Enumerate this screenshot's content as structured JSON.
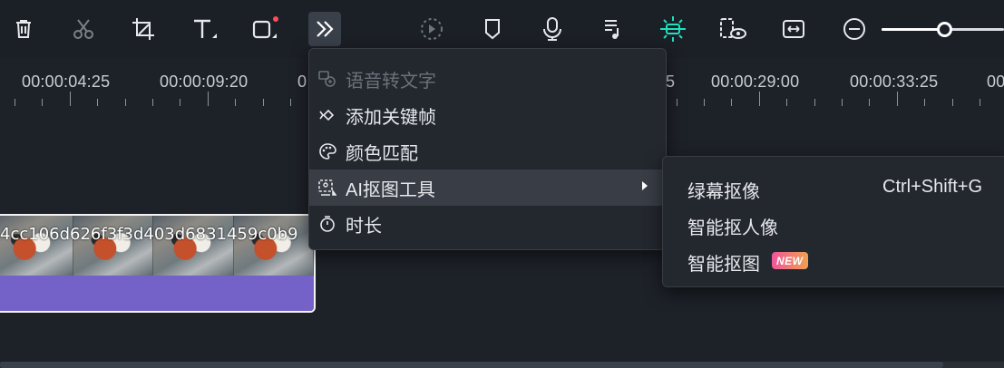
{
  "toolbar": {
    "buttons": [
      {
        "icon": "trash-icon",
        "name": "delete-button"
      },
      {
        "icon": "scissors-icon",
        "name": "split-button"
      },
      {
        "icon": "crop-icon",
        "name": "crop-button"
      },
      {
        "icon": "text-icon",
        "name": "text-button"
      },
      {
        "icon": "shape-icon",
        "name": "shape-button"
      },
      {
        "icon": "more-chevrons-icon",
        "name": "more-tools-button"
      },
      {
        "icon": "speed-icon",
        "name": "speed-button"
      },
      {
        "icon": "marker-icon",
        "name": "marker-button"
      },
      {
        "icon": "microphone-icon",
        "name": "record-voice-button"
      },
      {
        "icon": "music-list-icon",
        "name": "audio-button"
      },
      {
        "icon": "ai-track-icon",
        "name": "ai-button"
      },
      {
        "icon": "preview-render-icon",
        "name": "preview-button"
      },
      {
        "icon": "fit-width-icon",
        "name": "fit-button"
      },
      {
        "icon": "zoom-out-icon",
        "name": "zoom-out-button"
      }
    ],
    "zoom_level": 0.52,
    "accent_color": "#1fe0c0",
    "notification_dot_color": "#ff4d5a"
  },
  "ruler": {
    "timecodes": [
      "00:00:04:25",
      "00:00:09:20",
      "0",
      "5",
      "00:00:29:00",
      "00:00:33:25",
      "00"
    ]
  },
  "clip": {
    "name": "4cc106d626f3f3d403d6831459c0b9",
    "audio_color": "#7562c8"
  },
  "context_menu": {
    "items": [
      {
        "label": "语音转文字",
        "icon": "speech-to-text-icon",
        "disabled": true
      },
      {
        "label": "添加关键帧",
        "icon": "keyframe-icon",
        "disabled": false
      },
      {
        "label": "颜色匹配",
        "icon": "palette-icon",
        "disabled": false
      },
      {
        "label": "AI抠图工具",
        "icon": "ai-cutout-icon",
        "disabled": false,
        "has_submenu": true
      },
      {
        "label": "时长",
        "icon": "stopwatch-icon",
        "disabled": false
      }
    ]
  },
  "submenu": {
    "items": [
      {
        "label": "绿幕抠像",
        "shortcut": "Ctrl+Shift+G"
      },
      {
        "label": "智能抠人像",
        "shortcut": ""
      },
      {
        "label": "智能抠图",
        "badge": "NEW"
      }
    ]
  }
}
